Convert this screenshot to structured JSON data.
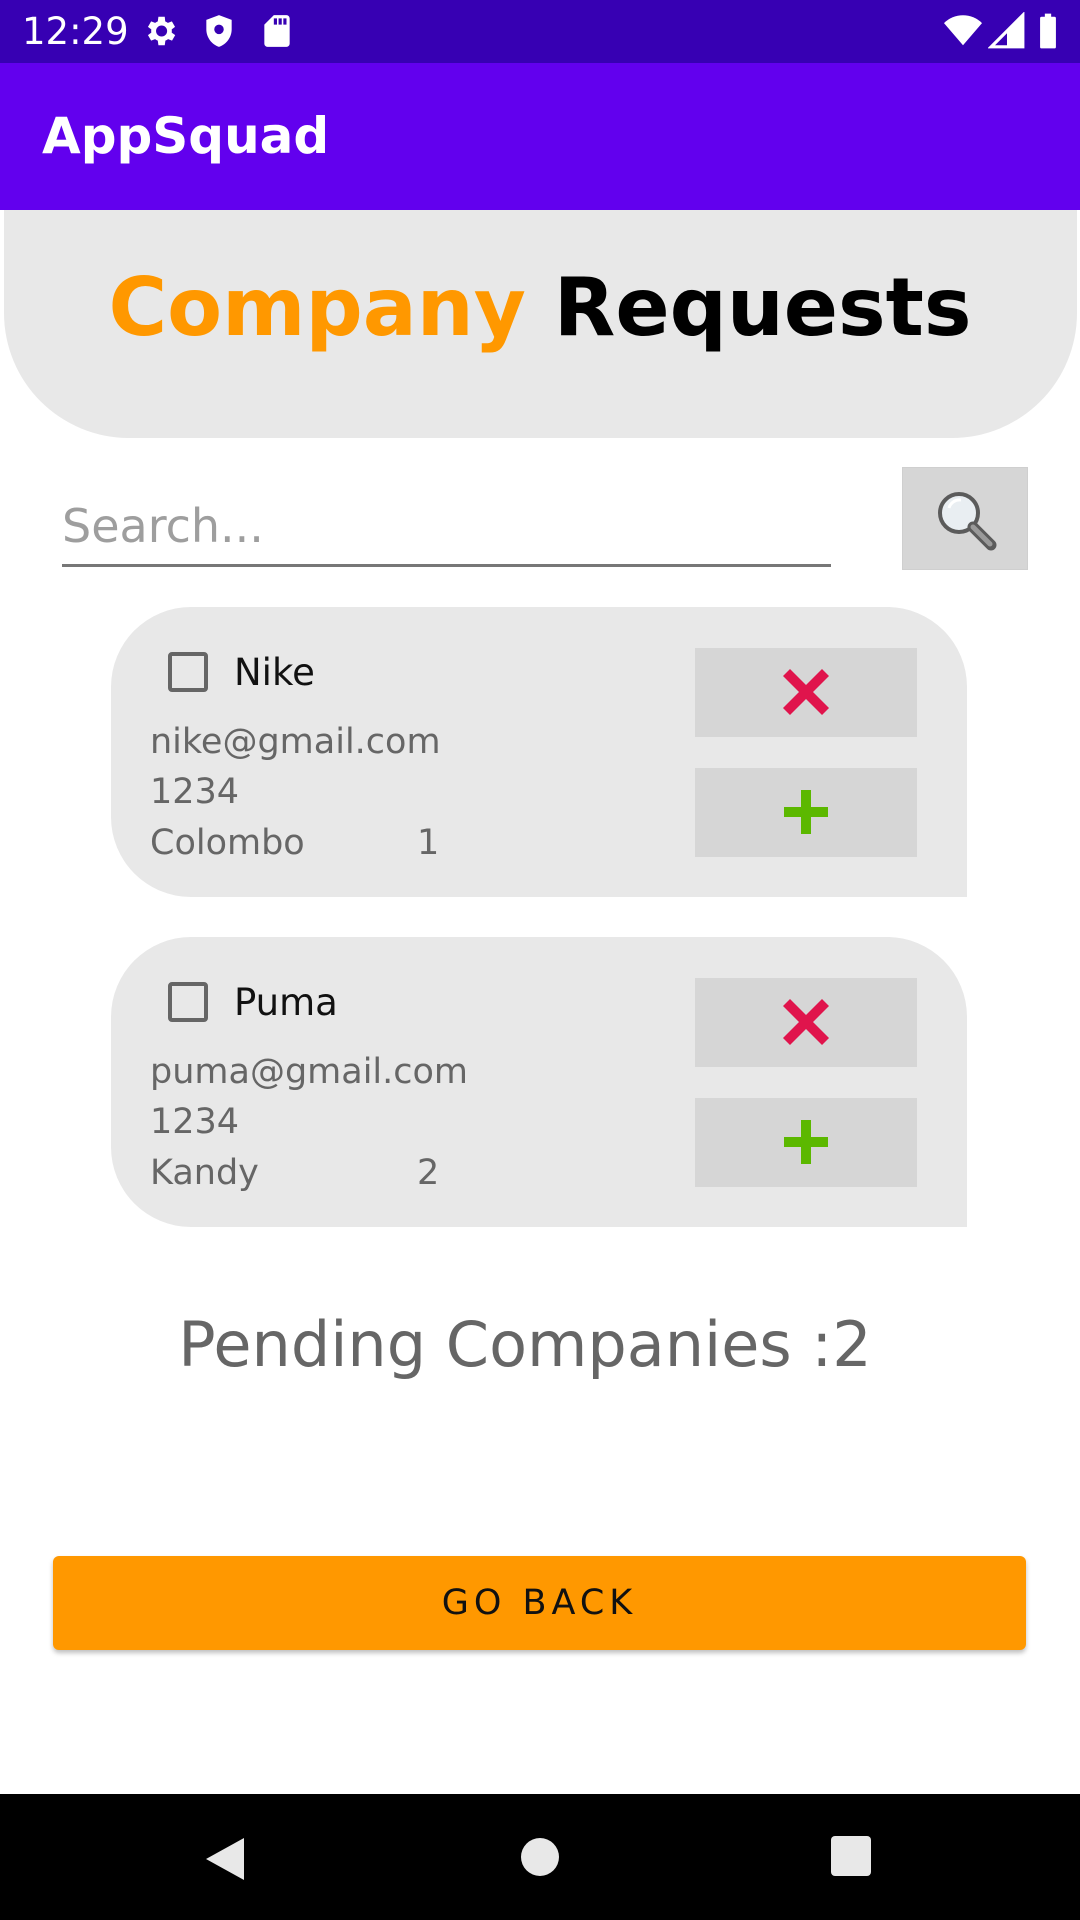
{
  "status_bar": {
    "time": "12:29",
    "icons_left": [
      "gear-icon",
      "shield-icon",
      "sd-card-icon"
    ],
    "icons_right": [
      "wifi-icon",
      "signal-icon",
      "battery-icon"
    ],
    "background": "#3700b3"
  },
  "app_bar": {
    "title": "AppSquad",
    "background": "#6200ee"
  },
  "header": {
    "title_part1": "Company",
    "title_part2": "Requests",
    "accent_color": "#ff9800"
  },
  "search": {
    "placeholder": "Search...",
    "value": "",
    "button_icon": "magnifier-icon"
  },
  "requests": [
    {
      "name": "Nike",
      "email": "nike@gmail.com",
      "phone": "1234",
      "city": "Colombo",
      "id": "1",
      "checked": false,
      "reject_icon": "red-x-icon",
      "approve_icon": "green-plus-icon"
    },
    {
      "name": "Puma",
      "email": "puma@gmail.com",
      "phone": "1234",
      "city": "Kandy",
      "id": "2",
      "checked": false,
      "reject_icon": "red-x-icon",
      "approve_icon": "green-plus-icon"
    }
  ],
  "pending": {
    "text": "Pending Companies :2"
  },
  "go_back": {
    "label": "GO BACK",
    "color": "#ff9800"
  },
  "nav_bar": {
    "icons": [
      "back-icon",
      "home-icon",
      "recents-icon"
    ]
  }
}
